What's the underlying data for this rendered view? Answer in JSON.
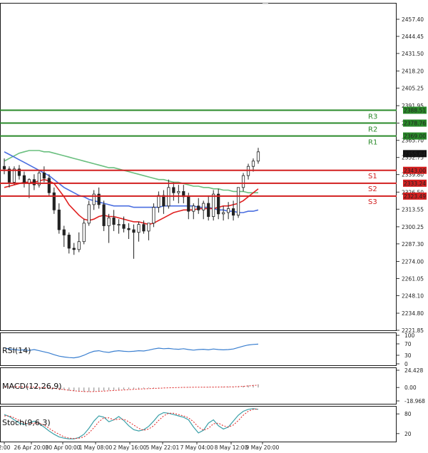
{
  "chart_data": {
    "type": "candlestick",
    "main": {
      "y_ticks": [
        "2457.40",
        "2444.45",
        "2431.50",
        "2418.20",
        "2405.25",
        "2391.95",
        "2378.75",
        "2365.70",
        "2352.75",
        "2339.80",
        "2326.50",
        "2313.55",
        "2300.25",
        "2287.30",
        "2274.00",
        "2261.05",
        "2248.10",
        "2234.80",
        "2221.85"
      ],
      "ylim": [
        2221.85,
        2457.4
      ],
      "x_ticks": [
        "2:00",
        "26 Apr 20:00",
        "30 Apr 00:00",
        "1 May 08:00",
        "2 May 16:00",
        "5 May 22:01",
        "7 May 04:00",
        "8 May 12:00",
        "9 May 20:00"
      ],
      "levels": [
        {
          "name": "R3",
          "value": 2388.51,
          "label": "2388.51",
          "color": "#2a8a2a"
        },
        {
          "name": "R2",
          "value": 2378.76,
          "label": "2378.76",
          "color": "#2a8a2a"
        },
        {
          "name": "R1",
          "value": 2369.0,
          "label": "2369.00",
          "color": "#2a8a2a"
        },
        {
          "name": "S1",
          "value": 2343.0,
          "label": "2343.00",
          "color": "#d22020"
        },
        {
          "name": "S2",
          "value": 2333.24,
          "label": "2333.24",
          "color": "#d22020"
        },
        {
          "name": "S3",
          "value": 2323.49,
          "label": "2323.49",
          "color": "#d22020"
        }
      ],
      "price": {
        "value": 2355.64,
        "label": "2355.64"
      },
      "candles": [
        [
          2346,
          2352,
          2340,
          2344
        ],
        [
          2344,
          2346,
          2330,
          2334
        ],
        [
          2334,
          2346,
          2332,
          2344
        ],
        [
          2344,
          2347,
          2336,
          2339
        ],
        [
          2339,
          2342,
          2330,
          2333
        ],
        [
          2333,
          2337,
          2322,
          2336
        ],
        [
          2336,
          2340,
          2328,
          2332
        ],
        [
          2332,
          2343,
          2330,
          2341
        ],
        [
          2341,
          2346,
          2334,
          2337
        ],
        [
          2337,
          2340,
          2324,
          2326
        ],
        [
          2326,
          2330,
          2310,
          2313
        ],
        [
          2313,
          2318,
          2295,
          2298
        ],
        [
          2298,
          2301,
          2285,
          2294
        ],
        [
          2294,
          2296,
          2280,
          2284
        ],
        [
          2284,
          2288,
          2279,
          2283
        ],
        [
          2283,
          2296,
          2281,
          2289
        ],
        [
          2289,
          2306,
          2287,
          2303
        ],
        [
          2303,
          2320,
          2301,
          2317
        ],
        [
          2317,
          2328,
          2313,
          2325
        ],
        [
          2325,
          2330,
          2314,
          2317
        ],
        [
          2317,
          2320,
          2297,
          2301
        ],
        [
          2301,
          2310,
          2288,
          2307
        ],
        [
          2307,
          2313,
          2297,
          2302
        ],
        [
          2302,
          2306,
          2295,
          2302
        ],
        [
          2302,
          2308,
          2296,
          2299
        ],
        [
          2299,
          2303,
          2291,
          2298
        ],
        [
          2298,
          2302,
          2276,
          2296
        ],
        [
          2296,
          2304,
          2289,
          2302
        ],
        [
          2302,
          2305,
          2295,
          2297
        ],
        [
          2297,
          2303,
          2290,
          2303
        ],
        [
          2303,
          2318,
          2300,
          2315
        ],
        [
          2315,
          2327,
          2311,
          2324
        ],
        [
          2324,
          2328,
          2310,
          2316
        ],
        [
          2316,
          2336,
          2314,
          2330
        ],
        [
          2330,
          2334,
          2320,
          2326
        ],
        [
          2326,
          2332,
          2318,
          2327
        ],
        [
          2327,
          2332,
          2318,
          2323
        ],
        [
          2323,
          2326,
          2306,
          2312
        ],
        [
          2312,
          2318,
          2306,
          2316
        ],
        [
          2316,
          2322,
          2310,
          2313
        ],
        [
          2313,
          2320,
          2306,
          2318
        ],
        [
          2318,
          2324,
          2305,
          2308
        ],
        [
          2308,
          2328,
          2305,
          2325
        ],
        [
          2325,
          2329,
          2306,
          2310
        ],
        [
          2310,
          2316,
          2305,
          2311
        ],
        [
          2311,
          2319,
          2306,
          2314
        ],
        [
          2314,
          2320,
          2305,
          2309
        ],
        [
          2309,
          2327,
          2307,
          2330
        ],
        [
          2330,
          2341,
          2327,
          2339
        ],
        [
          2339,
          2348,
          2336,
          2346
        ],
        [
          2346,
          2352,
          2342,
          2350
        ],
        [
          2350,
          2360,
          2348,
          2357
        ]
      ],
      "ma_fast": [
        2330,
        2331,
        2332,
        2333,
        2334,
        2334,
        2334,
        2335,
        2336,
        2335,
        2333,
        2328,
        2323,
        2317,
        2313,
        2309,
        2306,
        2305,
        2306,
        2308,
        2309,
        2308,
        2308,
        2307,
        2306,
        2305,
        2304,
        2304,
        2303,
        2302,
        2303,
        2305,
        2307,
        2309,
        2311,
        2312,
        2313,
        2313,
        2313,
        2314,
        2314,
        2314,
        2314,
        2315,
        2316,
        2316,
        2317,
        2318,
        2320,
        2323,
        2326,
        2329
      ],
      "ma_mid": [
        2357,
        2355,
        2353,
        2351,
        2349,
        2347,
        2345,
        2343,
        2341,
        2339,
        2336,
        2333,
        2330,
        2328,
        2326,
        2324,
        2323,
        2321,
        2320,
        2319,
        2318,
        2317,
        2316,
        2316,
        2316,
        2316,
        2315,
        2315,
        2315,
        2315,
        2315,
        2315,
        2316,
        2316,
        2316,
        2316,
        2316,
        2316,
        2316,
        2315,
        2315,
        2315,
        2314,
        2313,
        2313,
        2312,
        2312,
        2311,
        2311,
        2312,
        2312,
        2313
      ],
      "ma_slow": [
        2350,
        2352,
        2354,
        2356,
        2357,
        2358,
        2358,
        2358,
        2357,
        2357,
        2356,
        2355,
        2354,
        2353,
        2352,
        2351,
        2350,
        2349,
        2348,
        2347,
        2346,
        2345,
        2345,
        2344,
        2343,
        2342,
        2341,
        2340,
        2339,
        2338,
        2337,
        2336,
        2336,
        2335,
        2334,
        2334,
        2333,
        2332,
        2331,
        2331,
        2330,
        2330,
        2329,
        2329,
        2328,
        2328,
        2327,
        2327,
        2327,
        2326,
        2326,
        2326
      ]
    },
    "rsi": {
      "label": "RSI(14)",
      "ticks": [
        "100",
        "70",
        "30",
        "0"
      ],
      "ylim": [
        0,
        100
      ],
      "values": [
        56,
        52,
        50,
        48,
        49,
        47,
        50,
        46,
        42,
        38,
        32,
        27,
        24,
        22,
        21,
        24,
        30,
        38,
        44,
        46,
        42,
        40,
        44,
        46,
        44,
        43,
        44,
        46,
        45,
        48,
        52,
        55,
        53,
        54,
        52,
        51,
        53,
        50,
        48,
        50,
        51,
        49,
        52,
        50,
        49,
        50,
        52,
        57,
        62,
        66,
        68,
        69
      ]
    },
    "macd": {
      "label": "MACD(12,26,9)",
      "ticks": [
        "24.428",
        "0.00",
        "-18.968"
      ],
      "ylim": [
        -18.968,
        24.428
      ],
      "hist": [
        1,
        1,
        1,
        1,
        0.8,
        0.6,
        0.4,
        0.1,
        -0.3,
        -0.8,
        -1.5,
        -2.5,
        -3.5,
        -4.5,
        -5.2,
        -5.8,
        -6.2,
        -6.0,
        -5.5,
        -5.0,
        -4.5,
        -4.0,
        -3.6,
        -3.2,
        -2.8,
        -2.4,
        -2.0,
        -1.7,
        -1.4,
        -1.1,
        -0.8,
        -0.5,
        -0.2,
        0,
        0.2,
        0.4,
        0.5,
        0.5,
        0.4,
        0.4,
        0.5,
        0.6,
        0.7,
        0.8,
        0.9,
        1.0,
        1.2,
        1.6,
        2.2,
        3.0,
        3.8,
        4.5
      ],
      "signal": [
        1,
        1,
        1,
        0.9,
        0.8,
        0.6,
        0.4,
        0.1,
        -0.2,
        -0.6,
        -1.2,
        -2.0,
        -2.9,
        -3.8,
        -4.6,
        -5.2,
        -5.6,
        -5.8,
        -5.7,
        -5.4,
        -5.0,
        -4.6,
        -4.2,
        -3.8,
        -3.4,
        -3.0,
        -2.6,
        -2.2,
        -1.9,
        -1.6,
        -1.3,
        -1.0,
        -0.7,
        -0.4,
        -0.2,
        0,
        0.2,
        0.3,
        0.4,
        0.4,
        0.5,
        0.5,
        0.6,
        0.7,
        0.8,
        0.9,
        1.0,
        1.3,
        1.7,
        2.2,
        2.8,
        3.4
      ]
    },
    "stoch": {
      "label": "Stoch(9,6,3)",
      "ticks": [
        "80",
        "20"
      ],
      "ylim": [
        0,
        100
      ],
      "k": [
        78,
        72,
        62,
        52,
        48,
        52,
        58,
        50,
        40,
        28,
        18,
        10,
        6,
        4,
        4,
        8,
        18,
        36,
        58,
        74,
        70,
        56,
        62,
        72,
        60,
        44,
        32,
        28,
        32,
        42,
        58,
        76,
        84,
        82,
        78,
        74,
        70,
        62,
        40,
        22,
        30,
        52,
        62,
        44,
        34,
        40,
        58,
        76,
        88,
        94,
        96,
        94
      ],
      "d": [
        74,
        74,
        68,
        60,
        52,
        50,
        52,
        52,
        46,
        36,
        26,
        18,
        10,
        6,
        5,
        6,
        10,
        22,
        38,
        56,
        68,
        68,
        62,
        64,
        64,
        56,
        46,
        36,
        30,
        34,
        44,
        60,
        74,
        82,
        82,
        78,
        74,
        68,
        56,
        40,
        30,
        36,
        50,
        52,
        44,
        40,
        46,
        60,
        76,
        88,
        94,
        95
      ]
    }
  }
}
